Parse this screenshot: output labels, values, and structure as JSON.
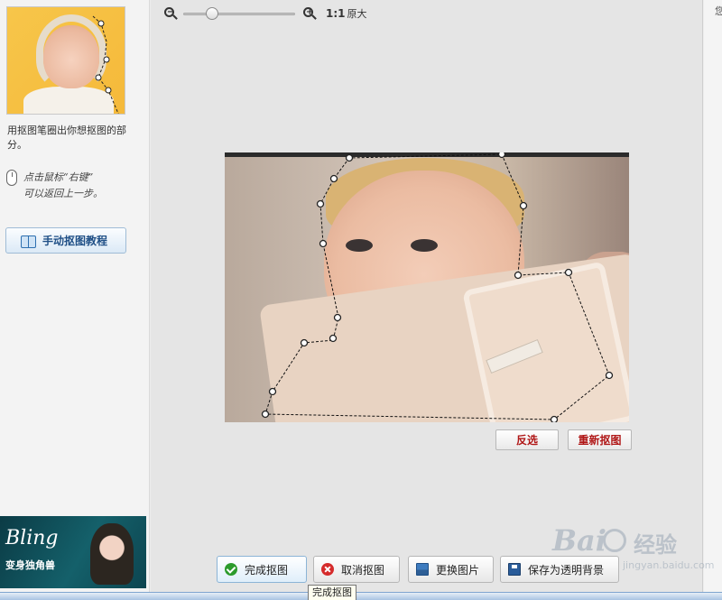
{
  "sidebar": {
    "instruction": "用抠图笔圈出你想抠图的部分。",
    "hint_line1": "点击鼠标“右键”",
    "hint_line2": "可以返回上一步。",
    "tutorial_button": "手动抠图教程",
    "ad": {
      "brand": "Bling",
      "slogan": "变身独角兽"
    }
  },
  "toolbar": {
    "zoom_out_icon": "zoom-out-icon",
    "zoom_in_icon": "zoom-in-icon",
    "ratio": "1:1",
    "ratio_label": "原大",
    "zoom_level": 0.23
  },
  "canvas": {
    "invert_button": "反选",
    "reset_button": "重新抠图"
  },
  "actions": {
    "done": "完成抠图",
    "cancel": "取消抠图",
    "change_image": "更换图片",
    "save_transparent": "保存为透明背景",
    "tooltip": "完成抠图"
  },
  "right_panel": {
    "glyph": "您"
  },
  "watermark": {
    "brand": "Bai",
    "jing": "经验",
    "url": "jingyan.baidu.com"
  },
  "colors": {
    "accent_red": "#b01717",
    "accent_blue": "#1f4f86",
    "check_green": "#2c9b2c",
    "cancel_red": "#d52b2b"
  }
}
